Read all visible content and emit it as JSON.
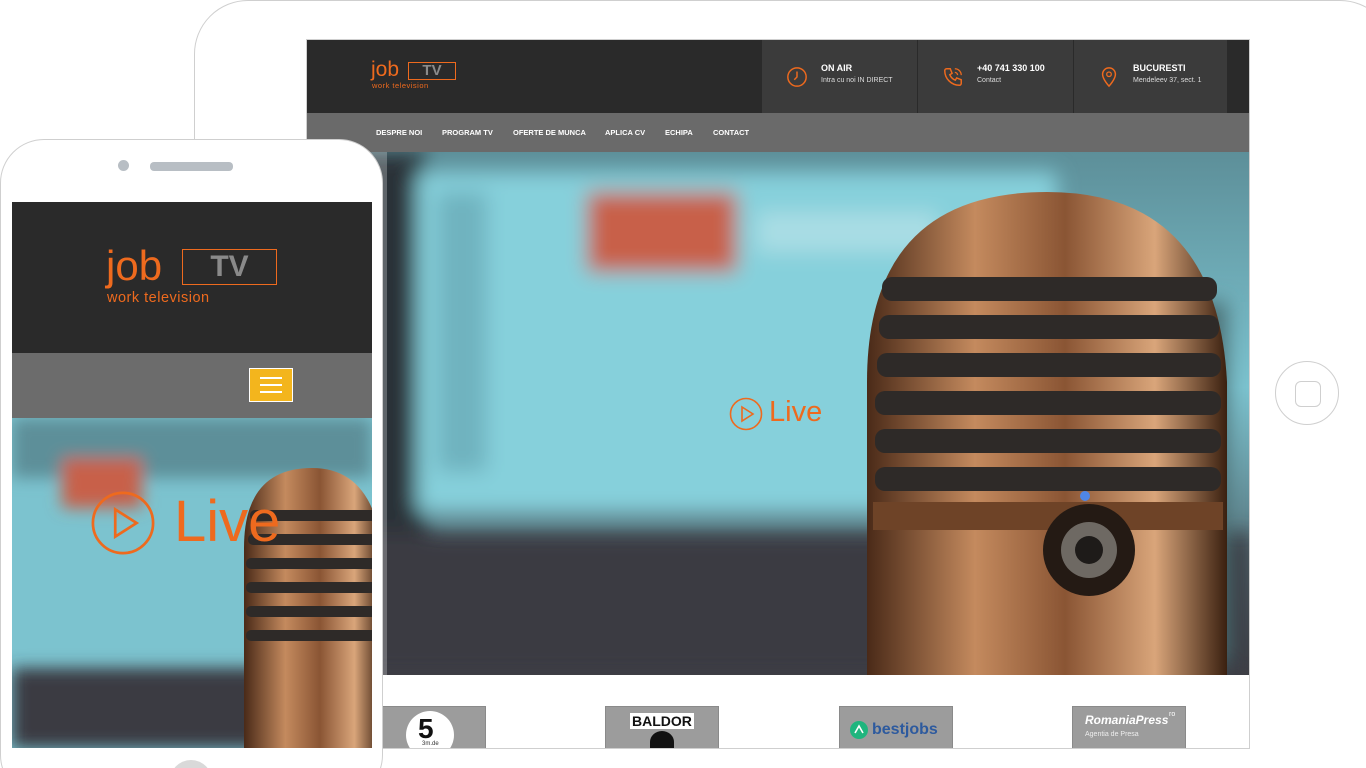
{
  "brand": {
    "job": "job",
    "tv": "TV",
    "tagline": "work television"
  },
  "header_info": [
    {
      "title": "ON AIR",
      "subtitle": "Intra cu noi IN DIRECT",
      "icon": "clock-icon"
    },
    {
      "title": "+40 741 330 100",
      "subtitle": "Contact",
      "icon": "phone-icon"
    },
    {
      "title": "BUCURESTI",
      "subtitle": "Mendeleev 37, sect. 1",
      "icon": "map-pin-icon"
    }
  ],
  "nav": [
    "DESPRE NOI",
    "PROGRAM TV",
    "OFERTE DE MUNCA",
    "APLICA CV",
    "ECHIPA",
    "CONTACT"
  ],
  "hero": {
    "live_label": "Live"
  },
  "partners": [
    {
      "label": "5",
      "sub": "3m.de"
    },
    {
      "label": "BALDOR"
    },
    {
      "label": "bestjobs"
    },
    {
      "label": "RomaniaPress",
      "suffix": "ro",
      "sub": "Agentia de Presa"
    }
  ],
  "colors": {
    "accent": "#ee6a1e",
    "dark": "#2a2a2a",
    "nav": "#6a6a6a",
    "menu_button": "#f3b51d"
  }
}
